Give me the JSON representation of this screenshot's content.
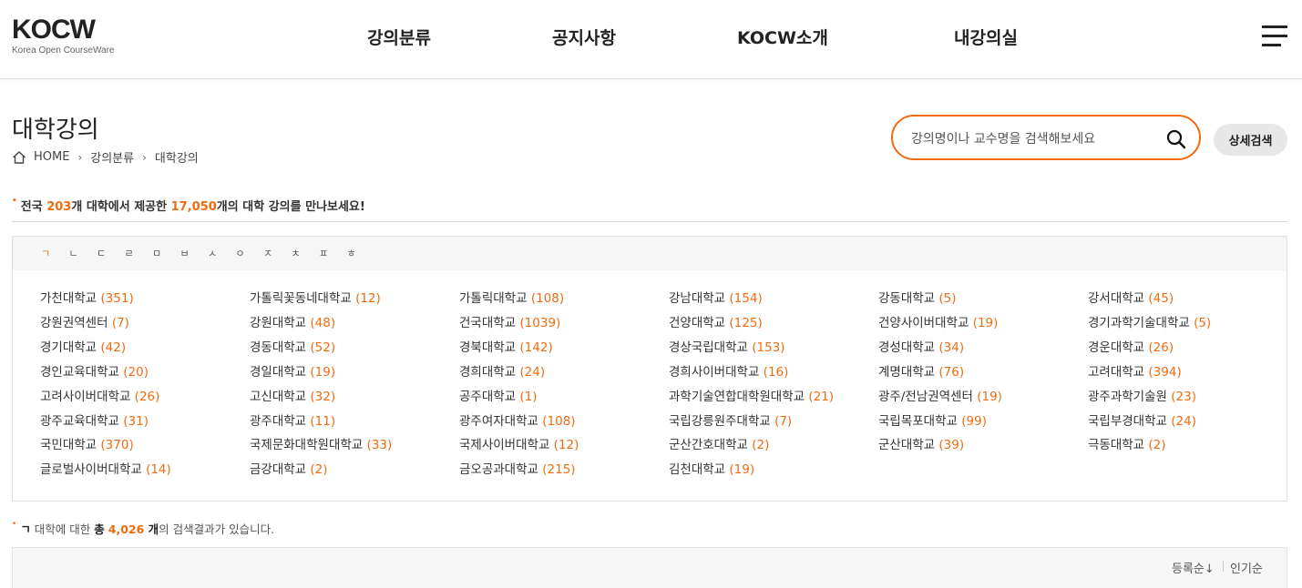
{
  "logo": {
    "mark": "KOCW",
    "subtitle": "Korea Open CourseWare"
  },
  "nav": [
    "강의분류",
    "공지사항",
    "KOCW소개",
    "내강의실"
  ],
  "page": {
    "title": "대학강의",
    "breadcrumb": [
      "HOME",
      "강의분류",
      "대학강의"
    ]
  },
  "search": {
    "placeholder": "강의명이나 교수명을 검색해보세요",
    "advanced_label": "상세검색"
  },
  "summary": {
    "prefix": "전국 ",
    "univ_count": "203",
    "mid": "개 대학에서 제공한 ",
    "lecture_count": "17,050",
    "suffix": "개의 대학 강의를 만나보세요!"
  },
  "consonants": [
    "ㄱ",
    "ㄴ",
    "ㄷ",
    "ㄹ",
    "ㅁ",
    "ㅂ",
    "ㅅ",
    "ㅇ",
    "ㅈ",
    "ㅊ",
    "ㅍ",
    "ㅎ"
  ],
  "active_consonant": "ㄱ",
  "universities": [
    {
      "name": "가천대학교",
      "count": "(351)"
    },
    {
      "name": "가톨릭꽃동네대학교",
      "count": "(12)"
    },
    {
      "name": "가톨릭대학교",
      "count": "(108)"
    },
    {
      "name": "강남대학교",
      "count": "(154)"
    },
    {
      "name": "강동대학교",
      "count": "(5)"
    },
    {
      "name": "강서대학교",
      "count": "(45)"
    },
    {
      "name": "강원권역센터",
      "count": "(7)"
    },
    {
      "name": "강원대학교",
      "count": "(48)"
    },
    {
      "name": "건국대학교",
      "count": "(1039)"
    },
    {
      "name": "건양대학교",
      "count": "(125)"
    },
    {
      "name": "건양사이버대학교",
      "count": "(19)"
    },
    {
      "name": "경기과학기술대학교",
      "count": "(5)"
    },
    {
      "name": "경기대학교",
      "count": "(42)"
    },
    {
      "name": "경동대학교",
      "count": "(52)"
    },
    {
      "name": "경북대학교",
      "count": "(142)"
    },
    {
      "name": "경상국립대학교",
      "count": "(153)"
    },
    {
      "name": "경성대학교",
      "count": "(34)"
    },
    {
      "name": "경운대학교",
      "count": "(26)"
    },
    {
      "name": "경인교육대학교",
      "count": "(20)"
    },
    {
      "name": "경일대학교",
      "count": "(19)"
    },
    {
      "name": "경희대학교",
      "count": "(24)"
    },
    {
      "name": "경희사이버대학교",
      "count": "(16)"
    },
    {
      "name": "계명대학교",
      "count": "(76)"
    },
    {
      "name": "고려대학교",
      "count": "(394)"
    },
    {
      "name": "고려사이버대학교",
      "count": "(26)"
    },
    {
      "name": "고신대학교",
      "count": "(32)"
    },
    {
      "name": "공주대학교",
      "count": "(1)"
    },
    {
      "name": "과학기술연합대학원대학교",
      "count": "(21)"
    },
    {
      "name": "광주/전남권역센터",
      "count": "(19)"
    },
    {
      "name": "광주과학기술원",
      "count": "(23)"
    },
    {
      "name": "광주교육대학교",
      "count": "(31)"
    },
    {
      "name": "광주대학교",
      "count": "(11)"
    },
    {
      "name": "광주여자대학교",
      "count": "(108)"
    },
    {
      "name": "국립강릉원주대학교",
      "count": "(7)"
    },
    {
      "name": "국립목포대학교",
      "count": "(99)"
    },
    {
      "name": "국립부경대학교",
      "count": "(24)"
    },
    {
      "name": "국민대학교",
      "count": "(370)"
    },
    {
      "name": "국제문화대학원대학교",
      "count": "(33)"
    },
    {
      "name": "국제사이버대학교",
      "count": "(12)"
    },
    {
      "name": "군산간호대학교",
      "count": "(2)"
    },
    {
      "name": "군산대학교",
      "count": "(39)"
    },
    {
      "name": "극동대학교",
      "count": "(2)"
    },
    {
      "name": "글로벌사이버대학교",
      "count": "(14)"
    },
    {
      "name": "금강대학교",
      "count": "(2)"
    },
    {
      "name": "금오공과대학교",
      "count": "(215)"
    },
    {
      "name": "김천대학교",
      "count": "(19)"
    }
  ],
  "result": {
    "consonant": "ㄱ",
    "text1": " 대학에 대한 ",
    "total_label": "총",
    "total": "4,026",
    "text2": " 개",
    "text3": "의 검색결과가 있습니다."
  },
  "sort": {
    "latest": "등록순↓",
    "popular": "인기순"
  },
  "colors": {
    "accent": "#f26b10",
    "text": "#222222",
    "bar": "#f6f6f6"
  }
}
